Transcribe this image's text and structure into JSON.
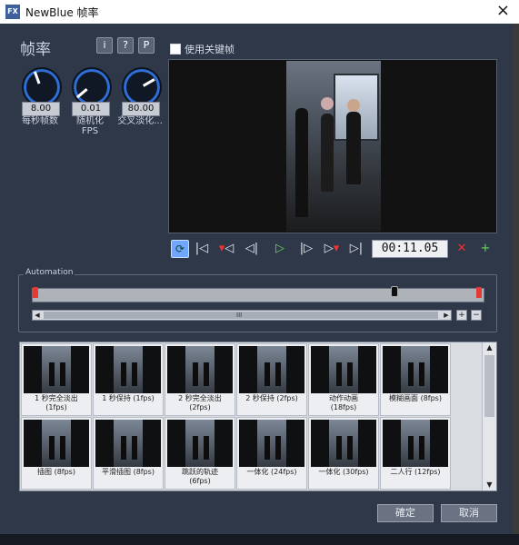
{
  "window": {
    "title": "NewBlue 帧率",
    "app_icon": "FX",
    "close": "×"
  },
  "effect": {
    "title": "帧率"
  },
  "header_buttons": {
    "info": "i",
    "help": "?",
    "preset": "P"
  },
  "knobs": [
    {
      "value": "8.00",
      "label": "每秒帧数",
      "level": 0.35
    },
    {
      "value": "0.01",
      "label": "随机化\nFPS",
      "level": 0.02
    },
    {
      "value": "80.00",
      "label": "交叉淡化...",
      "level": 0.8
    }
  ],
  "use_keyframes": {
    "label": "使用关键帧",
    "checked": false
  },
  "transport": {
    "loop_icon": "loop-icon",
    "timecode": "00:11.05"
  },
  "automation": {
    "legend": "Automation",
    "scroll_label": "III"
  },
  "presets": [
    {
      "label": "1 秒完全淡出\n(1fps)"
    },
    {
      "label": "1 秒保持 (1fps)"
    },
    {
      "label": "2 秒完全淡出\n(2fps)"
    },
    {
      "label": "2 秒保持 (2fps)"
    },
    {
      "label": "动作动画\n(18fps)"
    },
    {
      "label": "模糊画面 (8fps)"
    },
    {
      "label": "插图 (8fps)"
    },
    {
      "label": "平滑插图 (8fps)"
    },
    {
      "label": "跳跃的轨迹\n(6fps)"
    },
    {
      "label": "一体化 (24fps)"
    },
    {
      "label": "一体化 (30fps)"
    },
    {
      "label": "二人行 (12fps)"
    }
  ],
  "dialog_buttons": {
    "ok": "確定",
    "cancel": "取消"
  },
  "colors": {
    "panel": "#2e3849",
    "accent": "#2d6fd6",
    "keyframe": "#e53935"
  }
}
